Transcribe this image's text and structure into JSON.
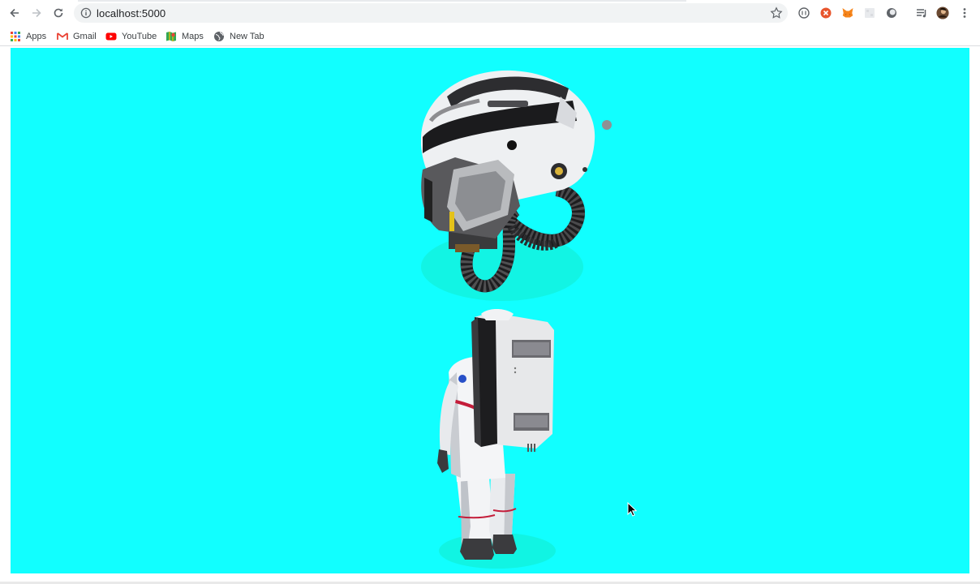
{
  "browser": {
    "url": "localhost:5000",
    "bookmarks": [
      {
        "label": "Apps",
        "icon": "apps-grid-icon"
      },
      {
        "label": "Gmail",
        "icon": "gmail-icon"
      },
      {
        "label": "YouTube",
        "icon": "youtube-icon"
      },
      {
        "label": "Maps",
        "icon": "maps-icon"
      },
      {
        "label": "New Tab",
        "icon": "globe-icon"
      }
    ],
    "extensions": [
      "extension-circle-icon",
      "extension-red-icon",
      "metamask-fox-icon",
      "extension-grey-icon",
      "extension-dark-icon",
      "media-queue-icon",
      "profile-avatar",
      "more-menu-icon"
    ]
  },
  "scene": {
    "background_color": "#11ffff",
    "models": [
      "helmet-model",
      "astronaut-model"
    ]
  }
}
